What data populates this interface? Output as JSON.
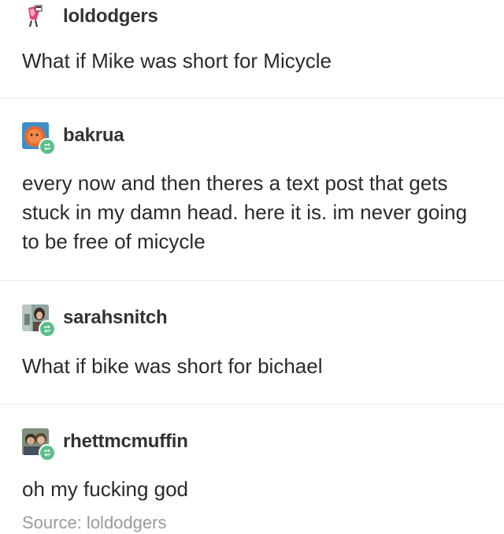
{
  "posts": [
    {
      "username": "loldodgers",
      "text": "What if Mike was short for Micycle",
      "reblog": false,
      "avatar_icon": "pink-figure-icon"
    },
    {
      "username": "bakrua",
      "text": "every now and then theres a text post that gets stuck in my damn head. here it is. im never going to be free of micycle",
      "reblog": true,
      "avatar_icon": "orange-face-icon"
    },
    {
      "username": "sarahsnitch",
      "text": "What if bike was short for bichael",
      "reblog": true,
      "avatar_icon": "photo-avatar-icon"
    },
    {
      "username": "rhettmcmuffin",
      "text": "oh my fucking god",
      "reblog": true,
      "avatar_icon": "photo-avatar-icon"
    }
  ],
  "source": "Source: loldodgers",
  "colors": {
    "reblog_badge": "#5bbf8a",
    "divider": "#e9e9e9",
    "text": "#2a2a2a",
    "source": "#9a9a9a"
  }
}
